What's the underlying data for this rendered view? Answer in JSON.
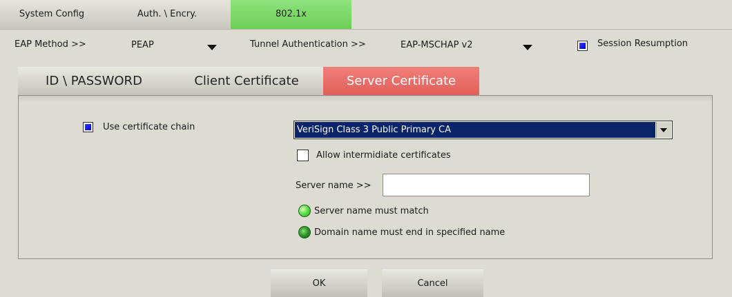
{
  "top_tabs": {
    "system_config": "System Config",
    "auth_encry": "Auth. \\ Encry.",
    "dot1x": "802.1x"
  },
  "eap": {
    "method_label": "EAP Method >>",
    "method_value": "PEAP",
    "tunnel_label": "Tunnel Authentication >>",
    "tunnel_value": "EAP-MSCHAP v2",
    "session_resumption_label": "Session Resumption",
    "session_resumption_checked": true
  },
  "inner_tabs": {
    "id_password": "ID \\ PASSWORD",
    "client_cert": "Client Certificate",
    "server_cert": "Server Certificate"
  },
  "server_cert": {
    "use_chain_label": "Use certificate chain",
    "use_chain_checked": true,
    "ca_selected": "VeriSign Class 3 Public Primary CA",
    "allow_intermediate_label": "Allow intermidiate certificates",
    "allow_intermediate_checked": false,
    "server_name_label": "Server name >>",
    "server_name_value": "",
    "opt_must_match": "Server name must match",
    "opt_domain_end": "Domain name must end in specified name"
  },
  "buttons": {
    "ok": "OK",
    "cancel": "Cancel"
  },
  "colors": {
    "active_top_tab": "#7ed86a",
    "active_inner_tab": "#e86b66",
    "select_highlight": "#0a246a"
  }
}
